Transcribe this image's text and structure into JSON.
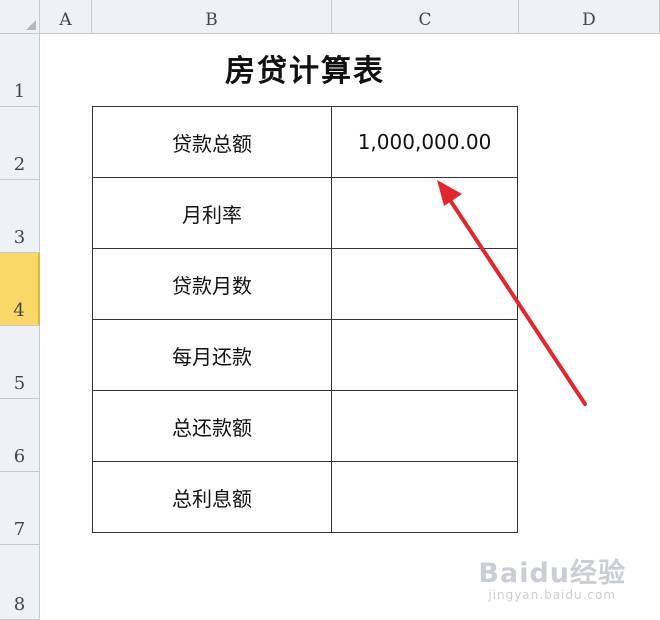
{
  "columns": [
    "A",
    "B",
    "C",
    "D"
  ],
  "rows": [
    "1",
    "2",
    "3",
    "4",
    "5",
    "6",
    "7",
    "8"
  ],
  "active_row": "4",
  "title": "房贷计算表",
  "table": [
    {
      "label": "贷款总额",
      "value": "1,000,000.00"
    },
    {
      "label": "月利率",
      "value": ""
    },
    {
      "label": "贷款月数",
      "value": ""
    },
    {
      "label": "每月还款",
      "value": ""
    },
    {
      "label": "总还款额",
      "value": ""
    },
    {
      "label": "总利息额",
      "value": ""
    }
  ],
  "annotation": {
    "color": "#e0282e"
  },
  "watermark": {
    "logo": "Baidu经验",
    "url": "jingyan.baidu.com"
  }
}
